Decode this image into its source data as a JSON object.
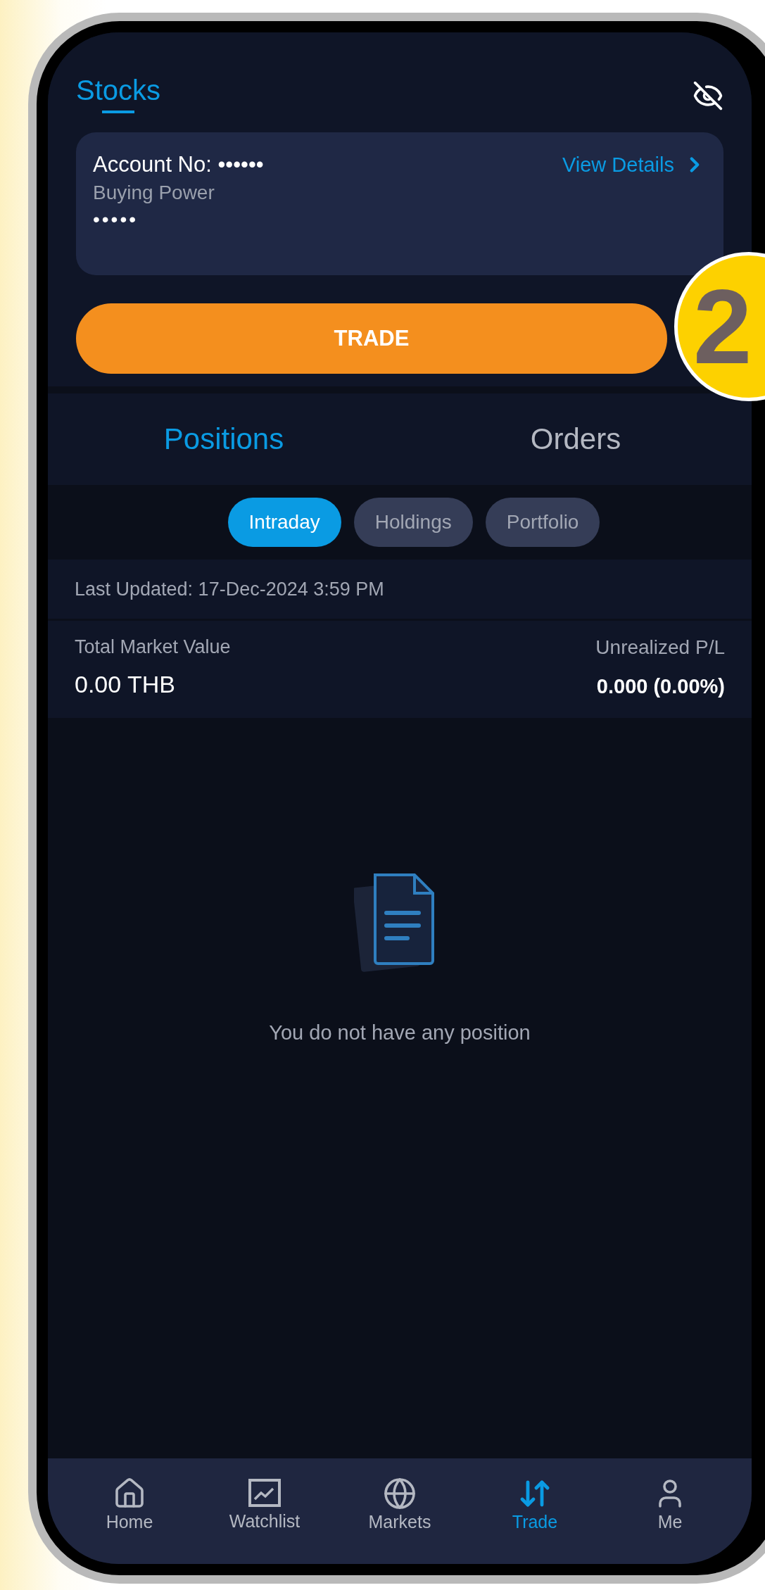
{
  "header": {
    "title": "Stocks"
  },
  "account": {
    "label": "Account No:",
    "number": "••••••",
    "link": "View Details",
    "buying_power_label": "Buying Power",
    "buying_power": "•••••"
  },
  "trade_button": "TRADE",
  "tabs": [
    {
      "label": "Positions",
      "selected": true
    },
    {
      "label": "Orders",
      "selected": false
    }
  ],
  "chips": [
    {
      "label": "Intraday",
      "selected": true
    },
    {
      "label": "Holdings",
      "selected": false
    },
    {
      "label": "Portfolio",
      "selected": false
    }
  ],
  "last_updated": "Last Updated: 17-Dec-2024 3:59 PM",
  "summary": {
    "market_value_label": "Total Market Value",
    "market_value": "0.00 THB",
    "pl_label": "Unrealized P/L",
    "pl": "0.000 (0.00%)"
  },
  "empty_state": "You do not have any position",
  "nav": [
    {
      "label": "Home",
      "kind": "home",
      "selected": false
    },
    {
      "label": "Watchlist",
      "kind": "watchlist",
      "selected": false
    },
    {
      "label": "Markets",
      "kind": "markets",
      "selected": false
    },
    {
      "label": "Trade",
      "kind": "trade",
      "selected": true
    },
    {
      "label": "Me",
      "kind": "me",
      "selected": false
    }
  ],
  "badge": "2"
}
